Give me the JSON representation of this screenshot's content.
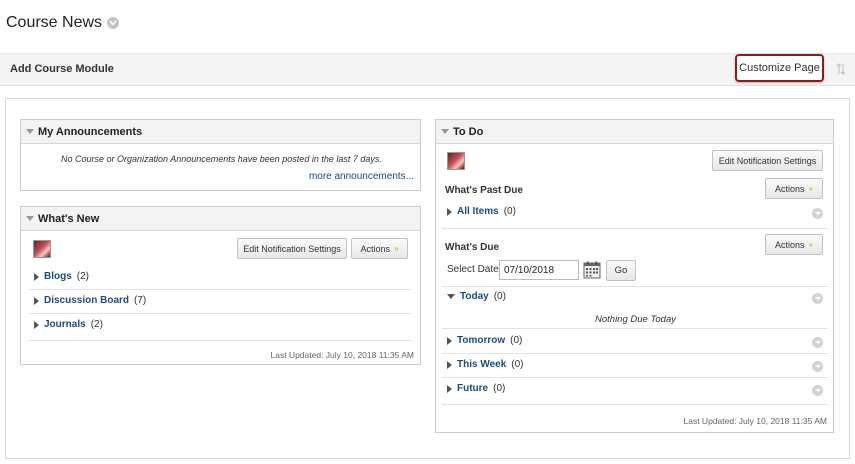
{
  "page": {
    "title": "Course News"
  },
  "toolbar": {
    "add_module": "Add Course Module",
    "customize": "Customize Page"
  },
  "announcements": {
    "title": "My Announcements",
    "message": "No Course or Organization Announcements have been posted in the last 7 days.",
    "more_link": "more announcements..."
  },
  "whats_new": {
    "title": "What's New",
    "edit_button": "Edit Notification Settings",
    "actions_button": "Actions",
    "items": [
      {
        "label": "Blogs",
        "count": "(2)"
      },
      {
        "label": "Discussion Board",
        "count": "(7)"
      },
      {
        "label": "Journals",
        "count": "(2)"
      }
    ],
    "last_updated": "Last Updated: July 10, 2018 11:35 AM"
  },
  "todo": {
    "title": "To Do",
    "edit_button": "Edit Notification Settings",
    "actions_button": "Actions",
    "past_due_heading": "What's Past Due",
    "all_items": {
      "label": "All Items",
      "count": "(0)"
    },
    "due_heading": "What's Due",
    "select_date_label": "Select Date:",
    "date_value": "07/10/2018",
    "go_button": "Go",
    "today": {
      "label": "Today",
      "count": "(0)"
    },
    "nothing_due": "Nothing Due Today",
    "tomorrow": {
      "label": "Tomorrow",
      "count": "(0)"
    },
    "this_week": {
      "label": "This Week",
      "count": "(0)"
    },
    "future": {
      "label": "Future",
      "count": "(0)"
    },
    "last_updated": "Last Updated: July 10, 2018 11:35 AM"
  },
  "icons": {
    "title_badge": "chevron-down-icon",
    "sort": "sort-arrows-icon",
    "calendar": "calendar-icon"
  },
  "colors": {
    "link": "#1a4c80",
    "highlight_border": "#8e1a1a",
    "actions_chevron": "#e5a200"
  }
}
